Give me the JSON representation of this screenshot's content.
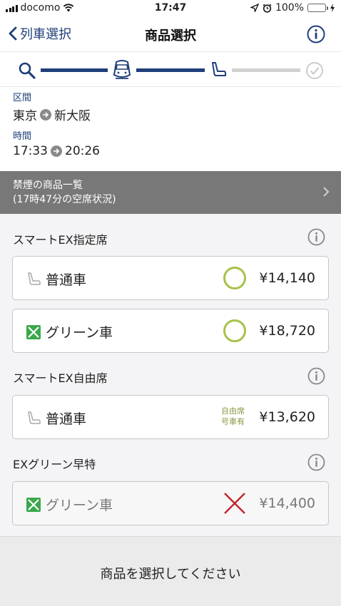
{
  "status_bar": {
    "carrier": "docomo",
    "time": "17:47",
    "battery": "100%",
    "battery_level": 1.0
  },
  "nav": {
    "back_label": "列車選択",
    "title": "商品選択"
  },
  "progress": {
    "steps": [
      "search-icon",
      "train-icon",
      "seat-icon",
      "check-icon"
    ],
    "current_step": 3,
    "active_color": "#1f3f7a",
    "inactive_color": "#d0d0d0"
  },
  "trip": {
    "section_label": "区間",
    "from": "東京",
    "to": "新大阪",
    "time_label": "時間",
    "depart": "17:33",
    "arrive": "20:26"
  },
  "banner": {
    "line1": "禁煙の商品一覧",
    "line2": "(17時47分の空席状況)"
  },
  "sections": [
    {
      "title": "スマートEX指定席",
      "rows": [
        {
          "car": "普通車",
          "car_icon": "seat-icon",
          "availability": "available",
          "price": "¥14,140"
        },
        {
          "car": "グリーン車",
          "car_icon": "green-car-icon",
          "availability": "available",
          "price": "¥18,720"
        }
      ]
    },
    {
      "title": "スマートEX自由席",
      "rows": [
        {
          "car": "普通車",
          "car_icon": "seat-icon",
          "note_line1": "自由席",
          "note_line2": "号車有",
          "price": "¥13,620"
        }
      ]
    },
    {
      "title": "EXグリーン早特",
      "rows": [
        {
          "car": "グリーン車",
          "car_icon": "green-car-icon",
          "availability": "unavailable",
          "price": "¥14,400"
        }
      ]
    }
  ],
  "footer": {
    "message": "商品を選択してください"
  },
  "colors": {
    "accent": "#1f3f7a",
    "available": "#a6c24a",
    "unavailable": "#c0262c",
    "green_car": "#3aa84b"
  }
}
